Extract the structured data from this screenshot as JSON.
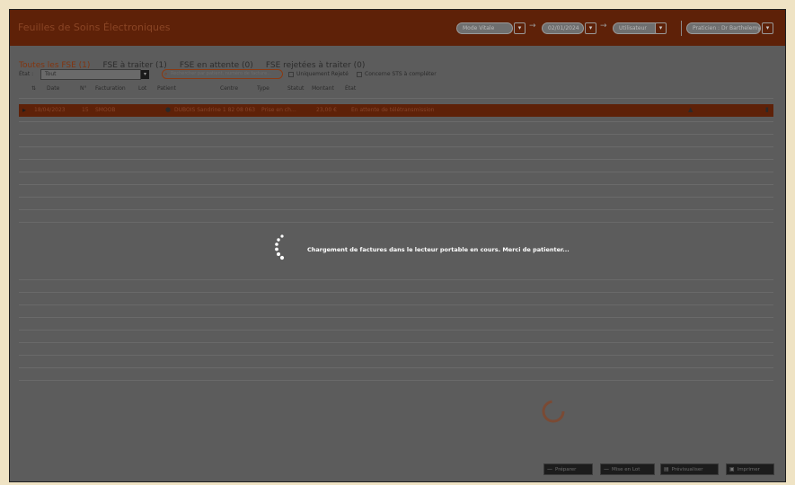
{
  "app": {
    "title": "Feuilles de Soins Électroniques",
    "toolbar": {
      "mode_select": "Mode Vitale",
      "date_select": "02/01/2024",
      "user_select": "Utilisateur",
      "praticien_select": "Praticien : Dr Barthelemy"
    }
  },
  "tabs": [
    {
      "label": "Toutes les FSE (1)"
    },
    {
      "label": "FSE à traiter (1)"
    },
    {
      "label": "FSE en attente (0)"
    },
    {
      "label": "FSE rejetées à traiter (0)"
    }
  ],
  "filters": {
    "etat_label": "État :",
    "etat_value": "Tout",
    "search_placeholder": "Rechercher par patient, numéro de facture…",
    "only_rejected": "Uniquement Rejeté",
    "only_sts": "Concerne STS à compléter"
  },
  "table": {
    "columns": [
      "Date",
      "N°",
      "Facturation",
      "Lot",
      "Patient",
      "Centre",
      "Type",
      "Statut",
      "Montant",
      "État"
    ],
    "rows": [
      {
        "date": "18/04/2023",
        "num": "15",
        "facturation": "SMOOB",
        "patient": "DUBOIS Sandrine 1 82 08 063",
        "type": "Prise en ch…",
        "montant": "23,00 €",
        "etat": "En attente de télétransmission"
      }
    ]
  },
  "loader": {
    "message": "Chargement de factures dans le lecteur portable en cours. Merci de patienter..."
  },
  "footer": {
    "buttons": [
      {
        "label": "Préparer",
        "icon": "dash-icon"
      },
      {
        "label": "Mise en Lot",
        "icon": "dash-icon"
      },
      {
        "label": "Prévisualiser",
        "icon": "document-icon"
      },
      {
        "label": "Imprimer",
        "icon": "printer-icon"
      }
    ]
  },
  "colors": {
    "accent": "#5e2108",
    "overlay": "#5c5c5c",
    "background": "#efe3c4"
  }
}
